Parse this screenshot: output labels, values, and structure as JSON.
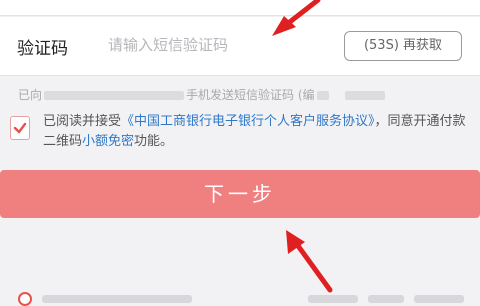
{
  "code_row": {
    "label": "验证码",
    "placeholder": "请输入短信验证码",
    "resend_label": "(53S) 再获取"
  },
  "sent_note": {
    "prefix": "已向",
    "middle": "手机发送短信验证码 (编"
  },
  "agreement": {
    "checked": true,
    "text_before": "已阅读并接受",
    "link_protocol": "《中国工商银行电子银行个人客户服务协议》",
    "text_mid": "，同意开通付款二维码",
    "link_feature": "小额免密",
    "text_after": "功能。"
  },
  "next_button": {
    "label": "下一步"
  },
  "colors": {
    "primary_button": "#f07f80",
    "link": "#2f78c8",
    "annotation_arrow": "#e02020"
  }
}
